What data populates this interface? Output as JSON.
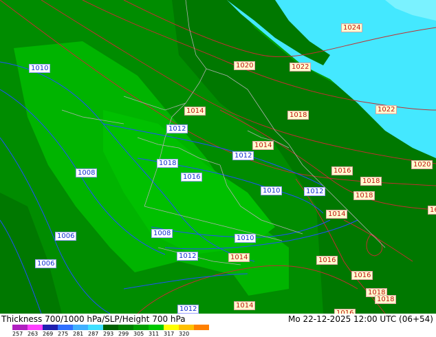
{
  "title": "Thickness 700/1000 hPa/SLP/Height 700 hPa",
  "datetime": "Mo 22-12-2025 12:00 UTC (06+54)",
  "colors": {
    "dark_green": "#007800",
    "mid_green": "#008c00",
    "green": "#00a000",
    "light_green": "#00b400",
    "bright_green": "#00c800",
    "cyan": "#44e8ff",
    "isobar_blue": "#2050ff",
    "isobar_red": "#c03030",
    "border": "#b0b0b0"
  },
  "colorbar": {
    "colors": [
      "#b020c0",
      "#ff40ff",
      "#2020b0",
      "#3070ff",
      "#40b0ff",
      "#40e0ff",
      "#006000",
      "#008000",
      "#00a000",
      "#00c800",
      "#ffff00",
      "#ffc000",
      "#ff8000"
    ],
    "ticks": [
      "257",
      "263",
      "269",
      "275",
      "281",
      "287",
      "293",
      "299",
      "305",
      "311",
      "317",
      "320"
    ]
  },
  "isobar_labels": [
    {
      "text": "1024",
      "color": "red"
    },
    {
      "text": "1020",
      "color": "red"
    },
    {
      "text": "1022",
      "color": "red"
    },
    {
      "text": "1010",
      "color": "blue"
    },
    {
      "text": "1014",
      "color": "red"
    },
    {
      "text": "1018",
      "color": "red"
    },
    {
      "text": "1022",
      "color": "red"
    },
    {
      "text": "1012",
      "color": "blue"
    },
    {
      "text": "1014",
      "color": "red"
    },
    {
      "text": "1012",
      "color": "blue"
    },
    {
      "text": "1018",
      "color": "blue"
    },
    {
      "text": "1020",
      "color": "red"
    },
    {
      "text": "1008",
      "color": "blue"
    },
    {
      "text": "1016",
      "color": "red"
    },
    {
      "text": "1018",
      "color": "red"
    },
    {
      "text": "1016",
      "color": "blue"
    },
    {
      "text": "1010",
      "color": "blue"
    },
    {
      "text": "1012",
      "color": "blue"
    },
    {
      "text": "1018",
      "color": "red"
    },
    {
      "text": "1014",
      "color": "red"
    },
    {
      "text": "1006",
      "color": "blue"
    },
    {
      "text": "1008",
      "color": "blue"
    },
    {
      "text": "1010",
      "color": "blue"
    },
    {
      "text": "1012",
      "color": "blue"
    },
    {
      "text": "1014",
      "color": "red"
    },
    {
      "text": "1016",
      "color": "red"
    },
    {
      "text": "1006",
      "color": "blue"
    },
    {
      "text": "1016",
      "color": "red"
    },
    {
      "text": "1018",
      "color": "red"
    },
    {
      "text": "1018",
      "color": "red"
    },
    {
      "text": "1012",
      "color": "blue"
    },
    {
      "text": "1014",
      "color": "red"
    },
    {
      "text": "1016",
      "color": "red"
    },
    {
      "text": "16",
      "color": "red"
    }
  ]
}
